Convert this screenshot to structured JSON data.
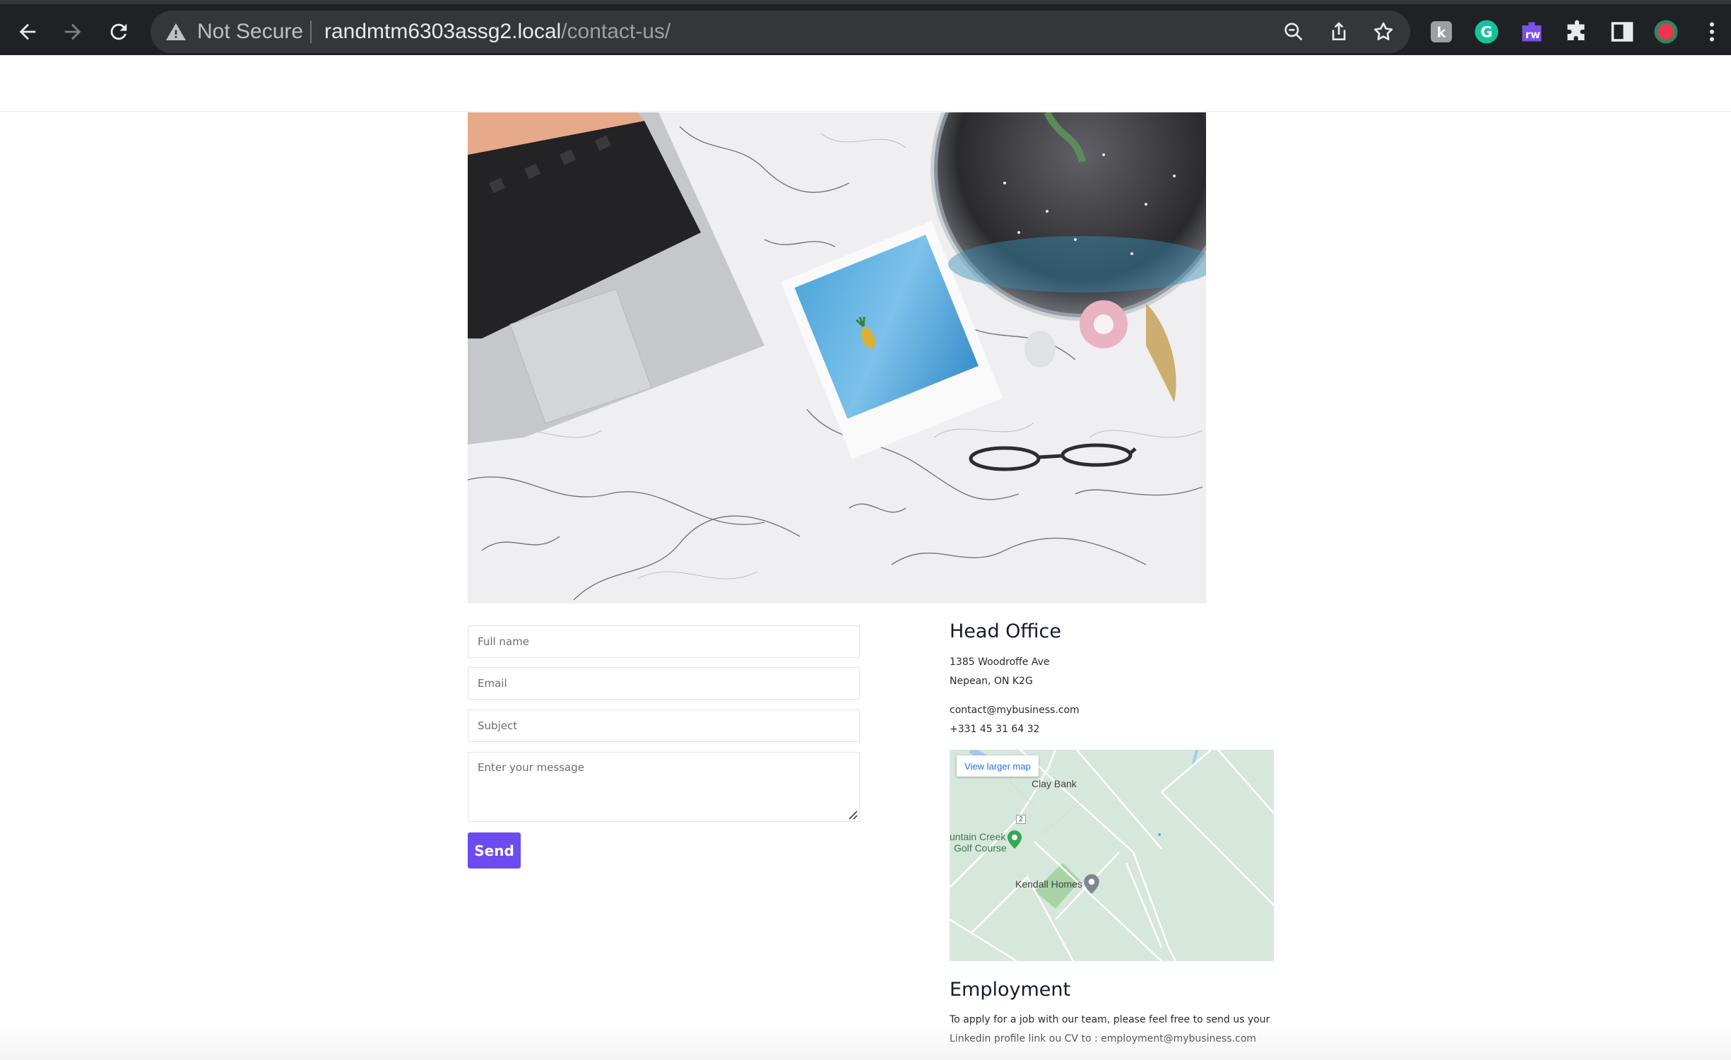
{
  "browser": {
    "security_label": "Not Secure",
    "url_host": "randmtm6303assg2.local",
    "url_path": "/contact-us/",
    "extensions": [
      "k-extension-icon",
      "grammarly-icon",
      "rw-extension-icon",
      "puzzle-icon",
      "sidepanel-icon",
      "profile-avatar"
    ],
    "ext_rw_label": "rw"
  },
  "form": {
    "full_name_placeholder": "Full name",
    "email_placeholder": "Email",
    "subject_placeholder": "Subject",
    "message_placeholder": "Enter your message",
    "send_label": "Send",
    "send_color": "#6c4bf0"
  },
  "head_office": {
    "title": "Head Office",
    "address_line1": "1385 Woodroffe Ave",
    "address_line2": "Nepean, ON K2G",
    "email": "contact@mybusiness.com",
    "phone": "+331 45 31 64 32"
  },
  "map": {
    "view_larger_label": "View larger map",
    "places": {
      "clay_bank": "Clay Bank",
      "golf_line1": "untain Creek",
      "golf_line2": "Golf Course",
      "kendall": "Kendall Homes",
      "road_number": "2"
    }
  },
  "employment": {
    "title": "Employment",
    "line1": "To apply for a job with our team, please feel free to send us your",
    "line2": "Linkedin profile link ou CV to : employment@mybusiness.com"
  }
}
